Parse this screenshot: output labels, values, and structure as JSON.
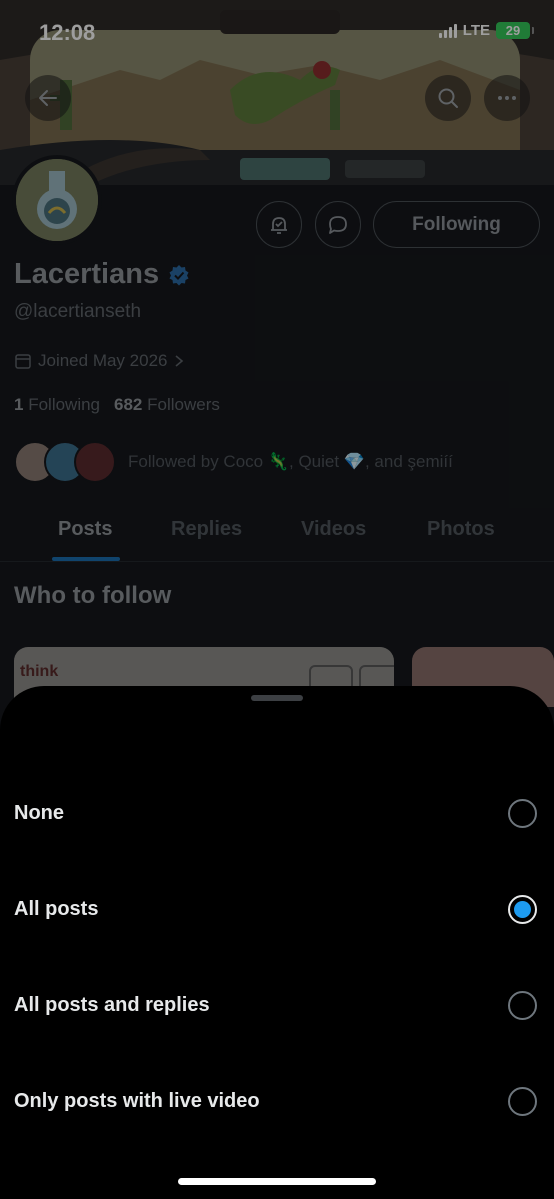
{
  "status_bar": {
    "time": "12:08",
    "network": "LTE",
    "battery": "29"
  },
  "profile": {
    "display_name": "Lacertians",
    "handle": "@lacertianseth",
    "joined": "Joined May 2026",
    "following_count": "1",
    "following_label": "Following",
    "followers_count": "682",
    "followers_label": "Followers",
    "followed_by": "Followed by Coco 🦎, Quiet 💎, and şemiíí",
    "following_button": "Following"
  },
  "tabs": [
    {
      "label": "Posts",
      "active": true
    },
    {
      "label": "Replies",
      "active": false
    },
    {
      "label": "Videos",
      "active": false
    },
    {
      "label": "Photos",
      "active": false
    }
  ],
  "who_to_follow": {
    "title": "Who to follow",
    "card_text": "think"
  },
  "sheet": {
    "options": [
      {
        "label": "None",
        "selected": false
      },
      {
        "label": "All posts",
        "selected": true
      },
      {
        "label": "All posts and replies",
        "selected": false
      },
      {
        "label": "Only posts with live video",
        "selected": false
      }
    ]
  },
  "colors": {
    "accent": "#1d9bf0",
    "sheet_bg": "#000000",
    "page_bg": "#15181c",
    "verified": "#1d9bf0"
  }
}
